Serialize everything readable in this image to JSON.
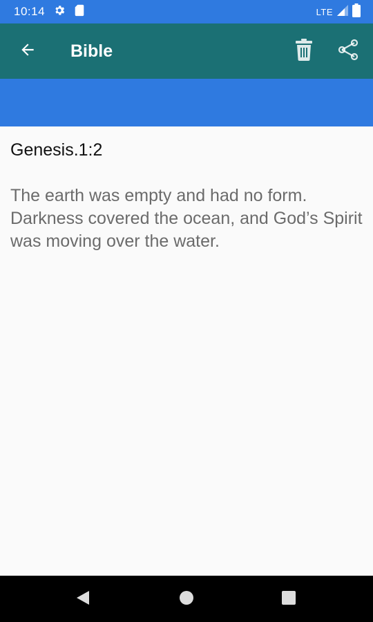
{
  "status_bar": {
    "time": "10:14",
    "network": "LTE",
    "icons": [
      "gear-icon",
      "sim-card-icon",
      "signal-icon",
      "battery-icon"
    ]
  },
  "toolbar": {
    "title": "Bible",
    "back_icon": "arrow-back-icon",
    "delete_icon": "trash-icon",
    "share_icon": "share-icon"
  },
  "verse": {
    "reference": "Genesis.1:2",
    "text": "The earth was empty and had no form. Darkness covered the ocean, and God’s Spirit was moving over the water."
  },
  "nav_bar": {
    "icons": [
      "back-triangle-icon",
      "home-circle-icon",
      "recents-square-icon"
    ]
  },
  "colors": {
    "status_bar": "#2f7ae0",
    "toolbar": "#1b7074",
    "band": "#2f7ae0",
    "background": "#fafafa",
    "reference_text": "#111111",
    "verse_text": "#6b6b6b"
  }
}
